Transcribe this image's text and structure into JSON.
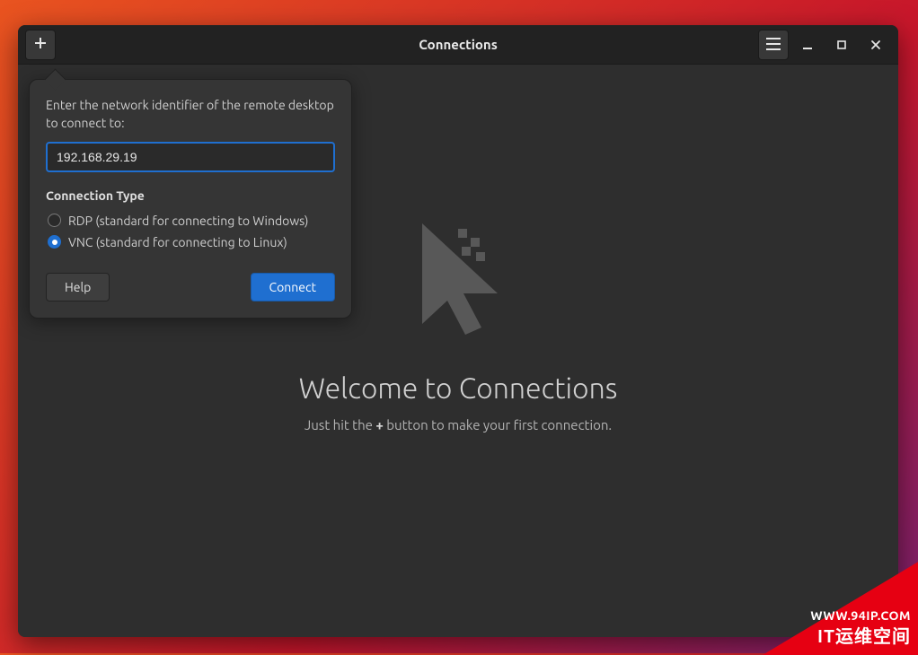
{
  "window": {
    "title": "Connections"
  },
  "main": {
    "welcome_title": "Welcome to Connections",
    "welcome_sub_prefix": "Just hit the ",
    "welcome_sub_plus": "+",
    "welcome_sub_suffix": " button to make your first connection."
  },
  "popover": {
    "prompt": "Enter the network identifier of the remote desktop to connect to:",
    "address_value": "192.168.29.19",
    "type_heading": "Connection Type",
    "options": {
      "rdp_label": "RDP (standard for connecting to Windows)",
      "vnc_label": "VNC (standard for connecting to Linux)"
    },
    "selected": "vnc",
    "buttons": {
      "help": "Help",
      "connect": "Connect"
    }
  },
  "watermark": {
    "line1": "WWW.94IP.COM",
    "line2": "IT运维空间"
  }
}
